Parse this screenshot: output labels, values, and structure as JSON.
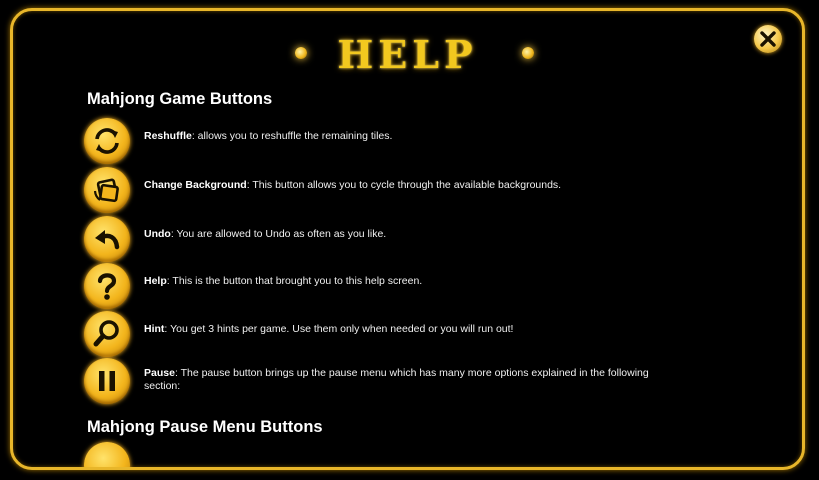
{
  "header": {
    "title": "HELP"
  },
  "close_icon": "close-icon",
  "colors": {
    "gold": "#f2c81f",
    "border": "#e8b62a",
    "background": "#000000",
    "text": "#ffffff"
  },
  "sections": {
    "game_buttons": {
      "heading": "Mahjong Game Buttons",
      "items": [
        {
          "icon": "reshuffle-icon",
          "name": "Reshuffle",
          "desc": ": allows you to reshuffle the remaining tiles."
        },
        {
          "icon": "change-background-icon",
          "name": "Change Background",
          "desc": ": This button allows you to cycle through the available backgrounds."
        },
        {
          "icon": "undo-icon",
          "name": "Undo",
          "desc": ": You are allowed to Undo as often as you like."
        },
        {
          "icon": "help-icon",
          "name": "Help",
          "desc": ": This is the button that brought you to this help screen."
        },
        {
          "icon": "hint-icon",
          "name": "Hint",
          "desc": ": You get 3 hints per game. Use them only when needed or you will run out!"
        },
        {
          "icon": "pause-icon",
          "name": "Pause",
          "desc": ": The pause button brings up the pause menu which has many more options explained in the following section:"
        }
      ]
    },
    "pause_menu_buttons": {
      "heading": "Mahjong Pause Menu Buttons"
    }
  }
}
